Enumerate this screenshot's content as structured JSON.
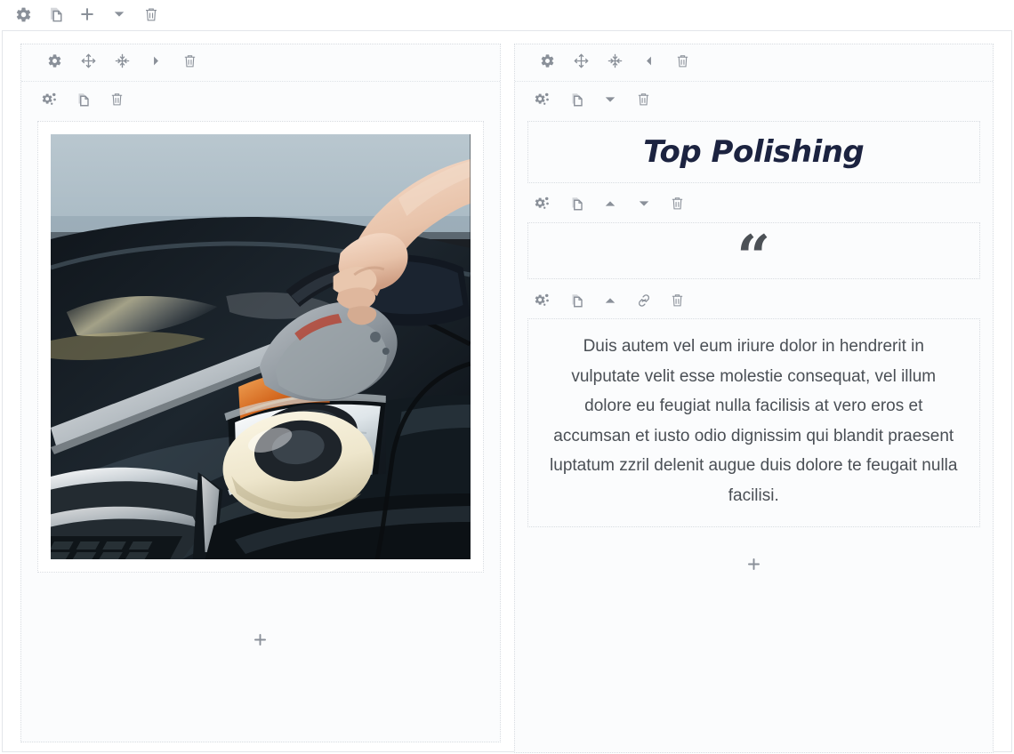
{
  "top_toolbar": {
    "buttons": [
      {
        "name": "settings",
        "icon": "gear-icon",
        "label": "Settings"
      },
      {
        "name": "duplicate",
        "icon": "copy-icon",
        "label": "Duplicate"
      },
      {
        "name": "add",
        "icon": "plus-icon",
        "label": "Add"
      },
      {
        "name": "move-down",
        "icon": "chevron-down-icon",
        "label": "Move down"
      },
      {
        "name": "delete",
        "icon": "trash-icon",
        "label": "Delete"
      }
    ]
  },
  "columns": [
    {
      "id": "left-column",
      "toolbar": [
        {
          "name": "settings",
          "icon": "gear-icon",
          "label": "Settings"
        },
        {
          "name": "move",
          "icon": "move-icon",
          "label": "Move"
        },
        {
          "name": "shrink",
          "icon": "shrink-icon",
          "label": "Shrink column"
        },
        {
          "name": "move-right",
          "icon": "chevron-right-icon",
          "label": "Move right"
        },
        {
          "name": "delete",
          "icon": "trash-icon",
          "label": "Delete"
        }
      ],
      "blocks": [
        {
          "type": "image",
          "toolbar": [
            {
              "name": "settings",
              "icon": "gears-icon",
              "label": "Block settings"
            },
            {
              "name": "duplicate",
              "icon": "copy-icon",
              "label": "Duplicate"
            },
            {
              "name": "delete",
              "icon": "trash-icon",
              "label": "Delete"
            }
          ],
          "image": {
            "alt": "Hand polishing the black hood of a car with an electric buffer",
            "subject": "car-polishing-photo"
          }
        }
      ],
      "add_label": "+"
    },
    {
      "id": "right-column",
      "toolbar": [
        {
          "name": "settings",
          "icon": "gear-icon",
          "label": "Settings"
        },
        {
          "name": "move",
          "icon": "move-icon",
          "label": "Move"
        },
        {
          "name": "shrink",
          "icon": "shrink-icon",
          "label": "Shrink column"
        },
        {
          "name": "move-left",
          "icon": "chevron-left-icon",
          "label": "Move left"
        },
        {
          "name": "delete",
          "icon": "trash-icon",
          "label": "Delete"
        }
      ],
      "blocks": [
        {
          "type": "heading",
          "toolbar": [
            {
              "name": "settings",
              "icon": "gears-icon",
              "label": "Block settings"
            },
            {
              "name": "duplicate",
              "icon": "copy-icon",
              "label": "Duplicate"
            },
            {
              "name": "move-down",
              "icon": "chevron-down-icon",
              "label": "Move down"
            },
            {
              "name": "delete",
              "icon": "trash-icon",
              "label": "Delete"
            }
          ],
          "text": "Top Polishing"
        },
        {
          "type": "quote",
          "toolbar": [
            {
              "name": "settings",
              "icon": "gears-icon",
              "label": "Block settings"
            },
            {
              "name": "duplicate",
              "icon": "copy-icon",
              "label": "Duplicate"
            },
            {
              "name": "move-up",
              "icon": "chevron-up-icon",
              "label": "Move up"
            },
            {
              "name": "move-down",
              "icon": "chevron-down-icon",
              "label": "Move down"
            },
            {
              "name": "delete",
              "icon": "trash-icon",
              "label": "Delete"
            }
          ],
          "mark": "“"
        },
        {
          "type": "text",
          "toolbar": [
            {
              "name": "settings",
              "icon": "gears-icon",
              "label": "Block settings"
            },
            {
              "name": "duplicate",
              "icon": "copy-icon",
              "label": "Duplicate"
            },
            {
              "name": "move-up",
              "icon": "chevron-up-icon",
              "label": "Move up"
            },
            {
              "name": "link",
              "icon": "link-icon",
              "label": "Insert link"
            },
            {
              "name": "delete",
              "icon": "trash-icon",
              "label": "Delete"
            }
          ],
          "body": "Duis autem vel eum iriure dolor in hendrerit in vulputate velit esse molestie consequat, vel illum dolore eu feugiat nulla facilisis at vero eros et accumsan et iusto odio dignissim qui blandit praesent luptatum zzril delenit augue duis dolore te feugait nulla facilisi."
        }
      ],
      "add_label": "+"
    }
  ],
  "colors": {
    "icon": "#8a9099",
    "heading": "#1c2340",
    "body_text": "#4a4f55",
    "quote_mark": "#4c5156",
    "dotted_border": "#d8dce1",
    "panel_bg": "#fbfcfd",
    "outer_border": "#e3e6ea"
  }
}
